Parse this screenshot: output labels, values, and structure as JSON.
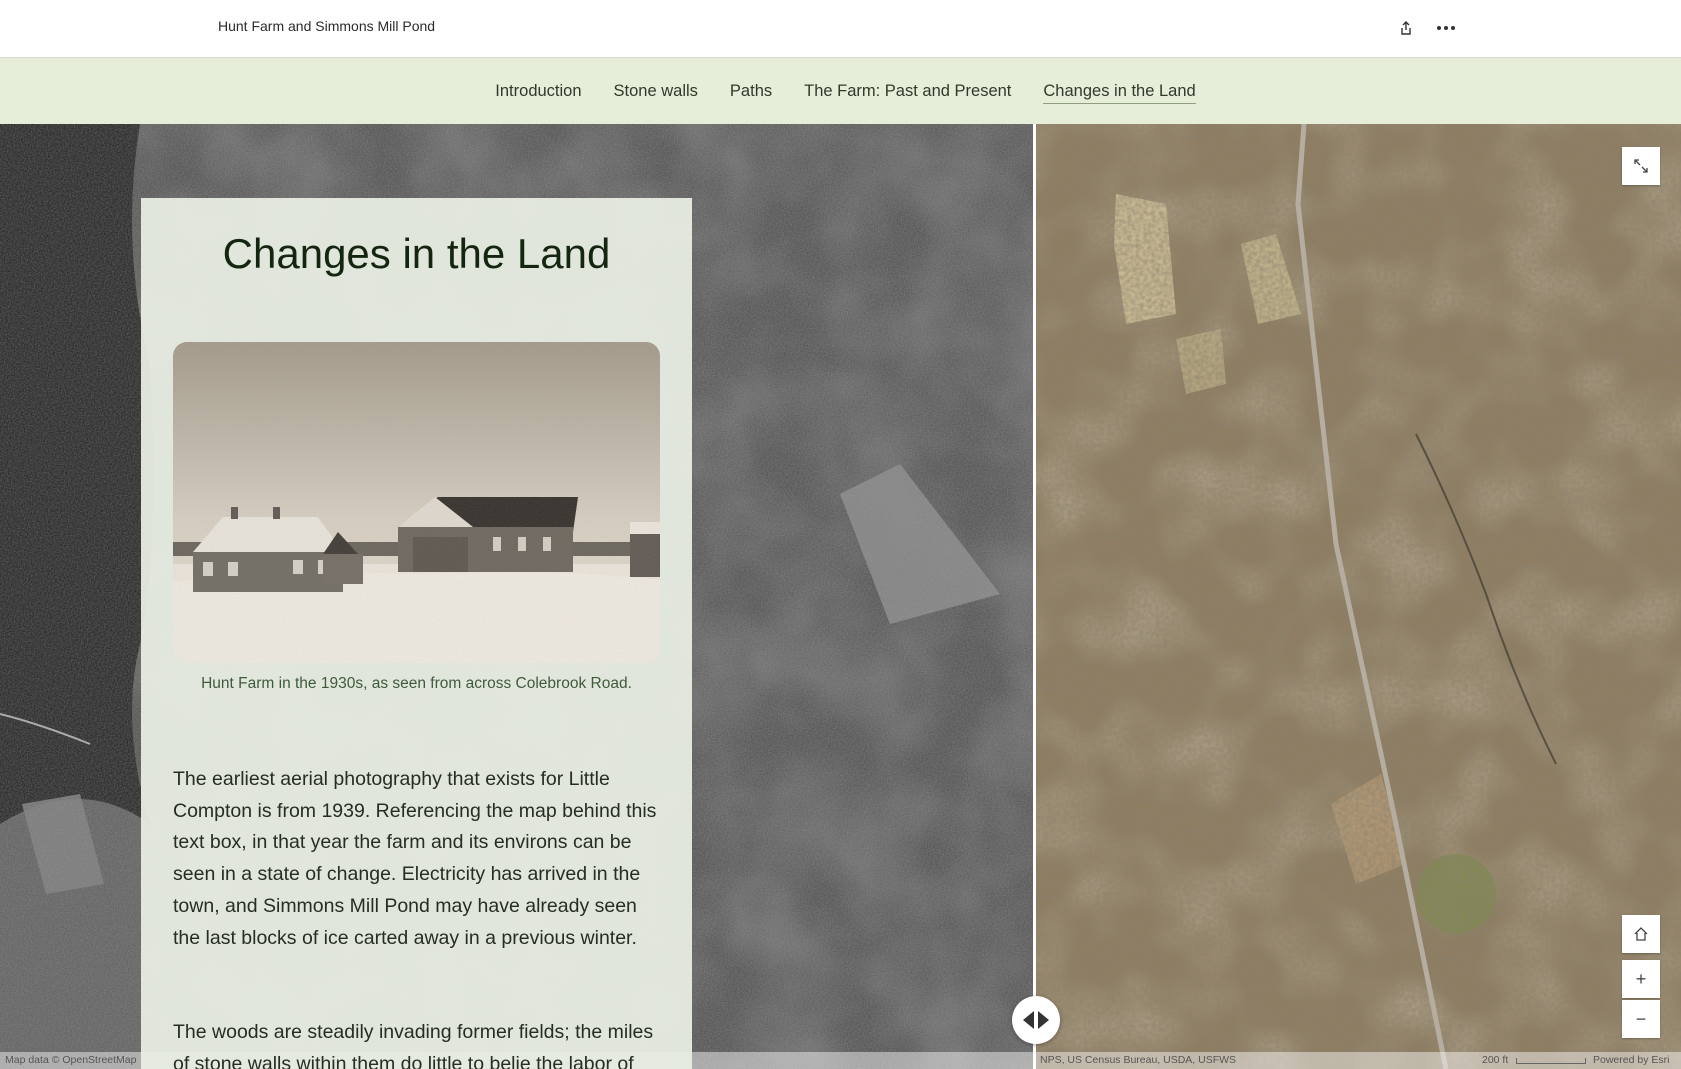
{
  "header": {
    "title": "Hunt Farm and Simmons Mill Pond",
    "share_icon": "share-icon",
    "more_icon": "more-options-icon"
  },
  "nav": {
    "items": [
      {
        "label": "Introduction",
        "active": false
      },
      {
        "label": "Stone walls",
        "active": false
      },
      {
        "label": "Paths",
        "active": false
      },
      {
        "label": "The Farm: Past and Present",
        "active": false
      },
      {
        "label": "Changes in the Land",
        "active": true
      }
    ]
  },
  "panel": {
    "title": "Changes in the Land",
    "caption": "Hunt Farm in the 1930s, as seen from across Colebrook Road.",
    "paragraphs": [
      "The earliest aerial photography that exists for Little Compton is from 1939. Referencing the map behind this text box, in that year the farm and its environs can be seen in a state of change. Electricity has arrived in the town, and Simmons Mill Pond may have already seen the last blocks of ice carted away in a previous winter.",
      "The woods are steadily invading former fields; the miles of stone walls within them do little to belie the labor of"
    ]
  },
  "map": {
    "attribution_left": "Map data © OpenStreetMap",
    "attribution_right": "NPS, US Census Bureau, USDA, USFWS",
    "scale_label": "200 ft",
    "powered_by": "Powered by Esri",
    "controls": {
      "expand_icon": "expand-icon",
      "home_icon": "home-icon",
      "zoom_in": "+",
      "zoom_out": "−"
    }
  }
}
